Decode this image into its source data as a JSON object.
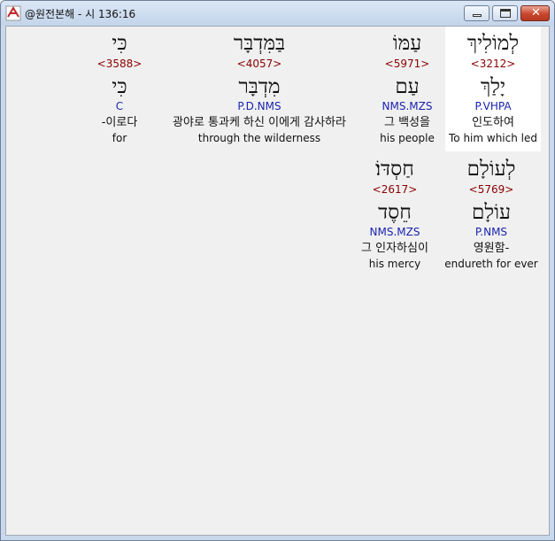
{
  "window": {
    "title": "@원전본해 - 시 136:16",
    "icon": "app-icon",
    "controls": {
      "minimize": "minimize-button",
      "maximize": "maximize-button",
      "close": "close-button"
    }
  },
  "words": [
    {
      "hebrew": "לְמוֹלִיךְ",
      "strong": "<3212>",
      "lemma": "יָלַךְ",
      "morph": "P.VHPA",
      "korean": "인도하여",
      "english": "To him which led"
    },
    {
      "hebrew": "עַמּוֹ",
      "strong": "<5971>",
      "lemma": "עַם",
      "morph": "NMS.MZS",
      "korean": "그 백성을",
      "english": "his people"
    },
    {
      "hebrew": "בַּמִּדְבָּר",
      "strong": "<4057>",
      "lemma": "מִדְבָּר",
      "morph": "P.D.NMS",
      "korean": "광야로 통과케 하신 이에게 감사하라",
      "english": "through the wilderness"
    },
    {
      "hebrew": "כִּי",
      "strong": "<3588>",
      "lemma": "כִּי",
      "morph": "C",
      "korean": "-이로다",
      "english": "for"
    },
    {
      "hebrew": "לְעוֹלָם",
      "strong": "<5769>",
      "lemma": "עוֹלָם",
      "morph": "P.NMS",
      "korean": "영원함-",
      "english": "endureth for ever"
    },
    {
      "hebrew": "חַסְדּוֹ׃",
      "strong": "<2617>",
      "lemma": "חֵסֶד",
      "morph": "NMS.MZS",
      "korean": "그 인자하심이",
      "english": "his mercy"
    }
  ]
}
